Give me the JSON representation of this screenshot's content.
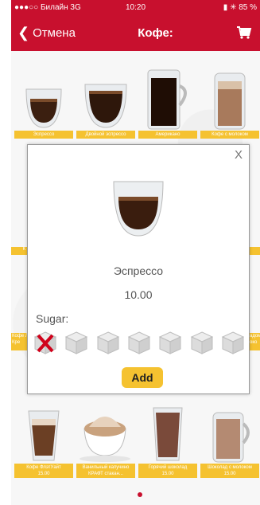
{
  "statusbar": {
    "carrier": "●●●○○ Билайн 3G",
    "time": "10:20",
    "battery": "▮ ✳ 85 %"
  },
  "navbar": {
    "back_label": "Отмена",
    "title": "Кофе:"
  },
  "grid": [
    {
      "label": "Эспрессо"
    },
    {
      "label": "Двойной эспрессо"
    },
    {
      "label": "Американо"
    },
    {
      "label": "Кофе с молоком"
    },
    {
      "label": "Кофе ФлэтУайт\n15.00"
    },
    {
      "label": "Ванильный капучино\nКРАФТ стакан..."
    },
    {
      "label": "Горячий шоколад\n15.00"
    },
    {
      "label": "Шоколад с молоком\n15.00"
    }
  ],
  "peek": {
    "left_mid": "К",
    "left_lower_1": "Кофе Л",
    "left_lower_2": "Кре",
    "right_lower_1": "адом",
    "right_lower_2": "око"
  },
  "dialog": {
    "close_label": "X",
    "product_name": "Эспрессо",
    "price": "10.00",
    "sugar_label": "Sugar:",
    "sugar_selected": 0,
    "sugar_levels": 7,
    "add_label": "Add"
  },
  "colors": {
    "brand_red": "#c8102e",
    "label_yellow": "#f5c230"
  }
}
